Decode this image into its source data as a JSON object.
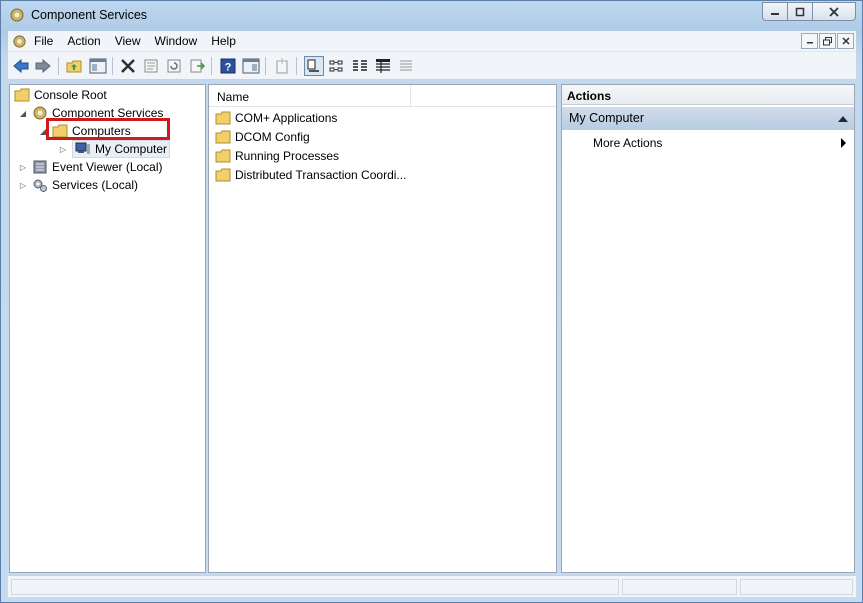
{
  "window": {
    "title": "Component Services"
  },
  "menubar": {
    "items": [
      "File",
      "Action",
      "View",
      "Window",
      "Help"
    ]
  },
  "toolbar": {
    "buttons": [
      "back-arrow-icon",
      "forward-arrow-icon",
      "up-folder-icon",
      "show-hide-tree-icon",
      "delete-icon",
      "properties-icon",
      "refresh-icon",
      "export-list-icon",
      "help-icon",
      "action-pane-icon",
      "new-window-icon",
      "large-icons-icon",
      "small-icons-icon",
      "list-view-icon",
      "detail-view-icon",
      "configure-icon"
    ]
  },
  "tree": {
    "items": [
      {
        "label": "Console Root"
      },
      {
        "label": "Component Services"
      },
      {
        "label": "Computers"
      },
      {
        "label": "My Computer"
      },
      {
        "label": "Event Viewer (Local)"
      },
      {
        "label": "Services (Local)"
      }
    ]
  },
  "list": {
    "column_name": "Name",
    "rows": [
      "COM+ Applications",
      "DCOM Config",
      "Running Processes",
      "Distributed Transaction Coordi..."
    ]
  },
  "actions": {
    "header": "Actions",
    "section_title": "My Computer",
    "more_actions": "More Actions"
  },
  "colors": {
    "highlight_box": "#d01919",
    "section_bg": "#c4d5e8",
    "folder": "#f1cf6a"
  }
}
